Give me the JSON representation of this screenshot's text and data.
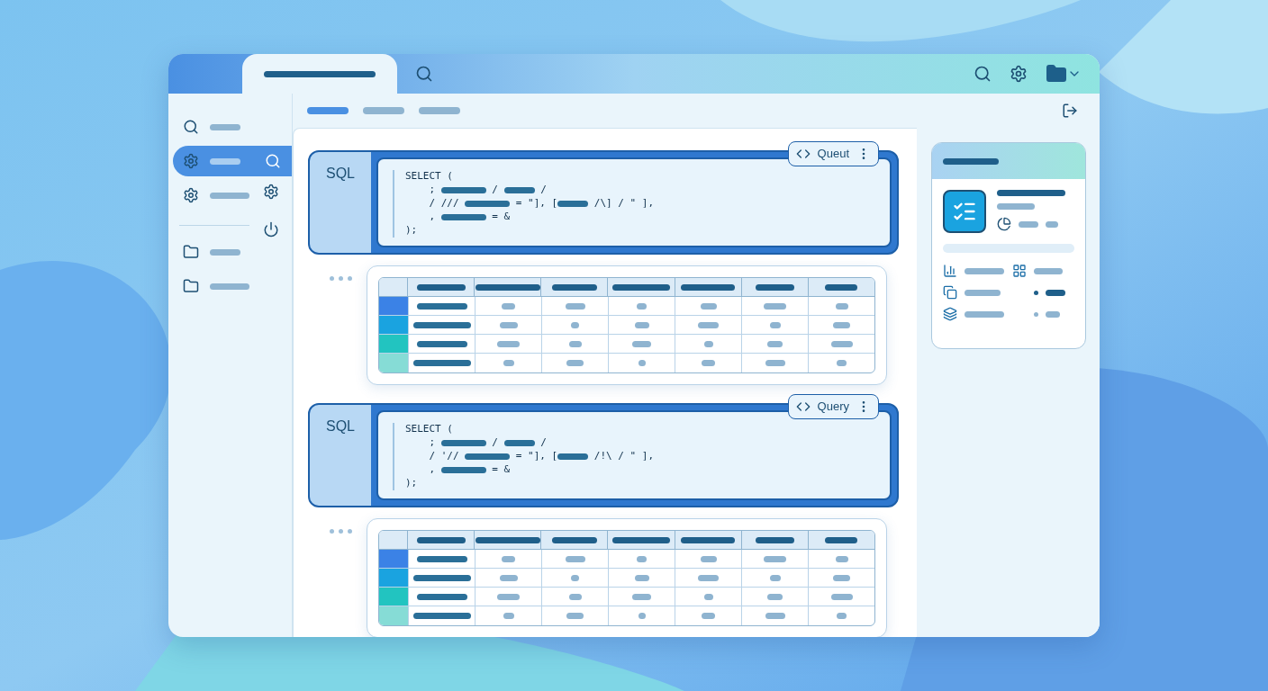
{
  "cells": [
    {
      "label": "SQL",
      "menu": "Queut",
      "lines": [
        [
          {
            "kind": "text",
            "text": "SELECT ("
          }
        ],
        [
          {
            "kind": "text",
            "text": "    ; "
          },
          {
            "kind": "bar"
          },
          {
            "kind": "text",
            "text": " / "
          },
          {
            "kind": "bar"
          },
          {
            "kind": "text",
            "text": " /"
          }
        ],
        [
          {
            "kind": "text",
            "text": "    / /// "
          },
          {
            "kind": "bar"
          },
          {
            "kind": "text",
            "text": " = \"], ["
          },
          {
            "kind": "bar"
          },
          {
            "kind": "text",
            "text": " /\\] / \" ],"
          }
        ],
        [
          {
            "kind": "text",
            "text": "    , "
          },
          {
            "kind": "bar"
          },
          {
            "kind": "text",
            "text": " = &"
          }
        ],
        [
          {
            "kind": "text",
            "text": ");"
          }
        ]
      ],
      "rows": [
        {
          "color": "#3b82e6"
        },
        {
          "color": "#1aa3e0"
        },
        {
          "color": "#22c4c0"
        },
        {
          "color": "#86dcd6"
        }
      ]
    },
    {
      "label": "SQL",
      "menu": "Query",
      "lines": [
        [
          {
            "kind": "text",
            "text": "SELECT ("
          }
        ],
        [
          {
            "kind": "text",
            "text": "    ; "
          },
          {
            "kind": "bar"
          },
          {
            "kind": "text",
            "text": " / "
          },
          {
            "kind": "bar"
          },
          {
            "kind": "text",
            "text": " /"
          }
        ],
        [
          {
            "kind": "text",
            "text": "    / '// "
          },
          {
            "kind": "bar"
          },
          {
            "kind": "text",
            "text": " = \"], ["
          },
          {
            "kind": "bar"
          },
          {
            "kind": "text",
            "text": " /!\\ / \" ],"
          }
        ],
        [
          {
            "kind": "text",
            "text": "    , "
          },
          {
            "kind": "bar"
          },
          {
            "kind": "text",
            "text": " = &"
          }
        ],
        [
          {
            "kind": "text",
            "text": ");"
          }
        ]
      ],
      "rows": [
        {
          "color": "#3b82e6"
        },
        {
          "color": "#1aa3e0"
        },
        {
          "color": "#22c4c0"
        },
        {
          "color": "#86dcd6"
        }
      ]
    }
  ],
  "sidebar": {
    "items": [
      {
        "kind": "search",
        "selected": false
      },
      {
        "kind": "gear",
        "selected": true
      },
      {
        "kind": "gear",
        "selected": false
      },
      {
        "kind": "folder",
        "selected": false
      },
      {
        "kind": "folder",
        "selected": false
      }
    ]
  },
  "toolbar": {
    "tabs": [
      {
        "selected": true
      },
      {
        "selected": false
      },
      {
        "selected": false
      }
    ]
  }
}
